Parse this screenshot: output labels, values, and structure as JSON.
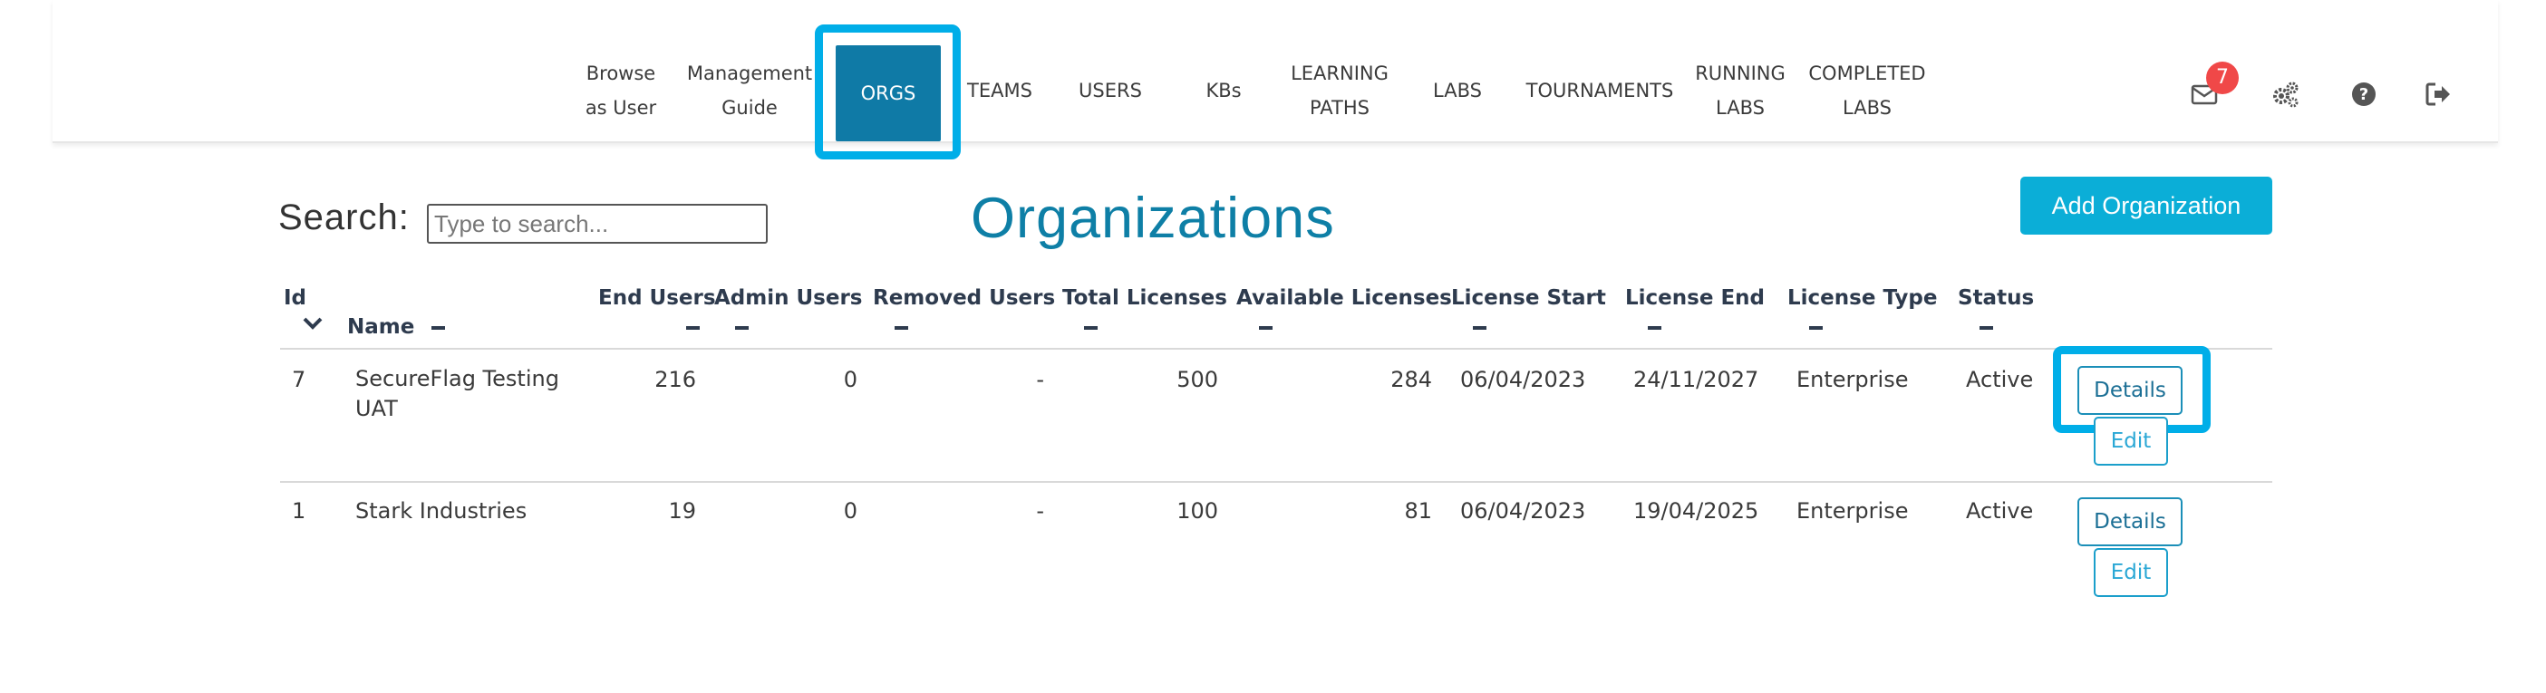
{
  "nav": {
    "items": [
      {
        "label": "Browse\nas User"
      },
      {
        "label": "Management\nGuide"
      },
      {
        "label": "ORGS"
      },
      {
        "label": "TEAMS"
      },
      {
        "label": "USERS"
      },
      {
        "label": "KBs"
      },
      {
        "label": "LEARNING\nPATHS"
      },
      {
        "label": "LABS"
      },
      {
        "label": "TOURNAMENTS"
      },
      {
        "label": "RUNNING\nLABS"
      },
      {
        "label": "COMPLETED\nLABS"
      }
    ],
    "active_item": "ORGS",
    "icons": [
      "envelope-icon",
      "gears-icon",
      "question-circle-icon",
      "sign-out-icon"
    ],
    "notification_count": "7"
  },
  "search": {
    "label": "Search:",
    "placeholder": "Type to search..."
  },
  "page": {
    "title": "Organizations",
    "add_button": "Add Organization"
  },
  "table": {
    "headers": {
      "id": "Id",
      "name": "Name",
      "end_users": "End Users",
      "admin_users": "Admin Users",
      "removed_users": "Removed Users",
      "total_licenses": "Total Licenses",
      "available_licenses": "Available Licenses",
      "license_start": "License Start",
      "license_end": "License End",
      "license_type": "License Type",
      "status": "Status"
    },
    "rows": [
      {
        "id": "7",
        "name": "SecureFlag Testing UAT",
        "end_users": "216",
        "admin_users": "0",
        "removed_users": "-",
        "total_licenses": "500",
        "available_licenses": "284",
        "license_start": "06/04/2023",
        "license_end": "24/11/2027",
        "license_type": "Enterprise",
        "status": "Active",
        "details_label": "Details",
        "edit_label": "Edit"
      },
      {
        "id": "1",
        "name": "Stark Industries",
        "end_users": "19",
        "admin_users": "0",
        "removed_users": "-",
        "total_licenses": "100",
        "available_licenses": "81",
        "license_start": "06/04/2023",
        "license_end": "19/04/2025",
        "license_type": "Enterprise",
        "status": "Active",
        "details_label": "Details",
        "edit_label": "Edit"
      }
    ]
  },
  "colors": {
    "accent": "#0f7aa6",
    "highlight": "#00aee8",
    "add_button": "#0baed7",
    "badge": "#f04848"
  }
}
